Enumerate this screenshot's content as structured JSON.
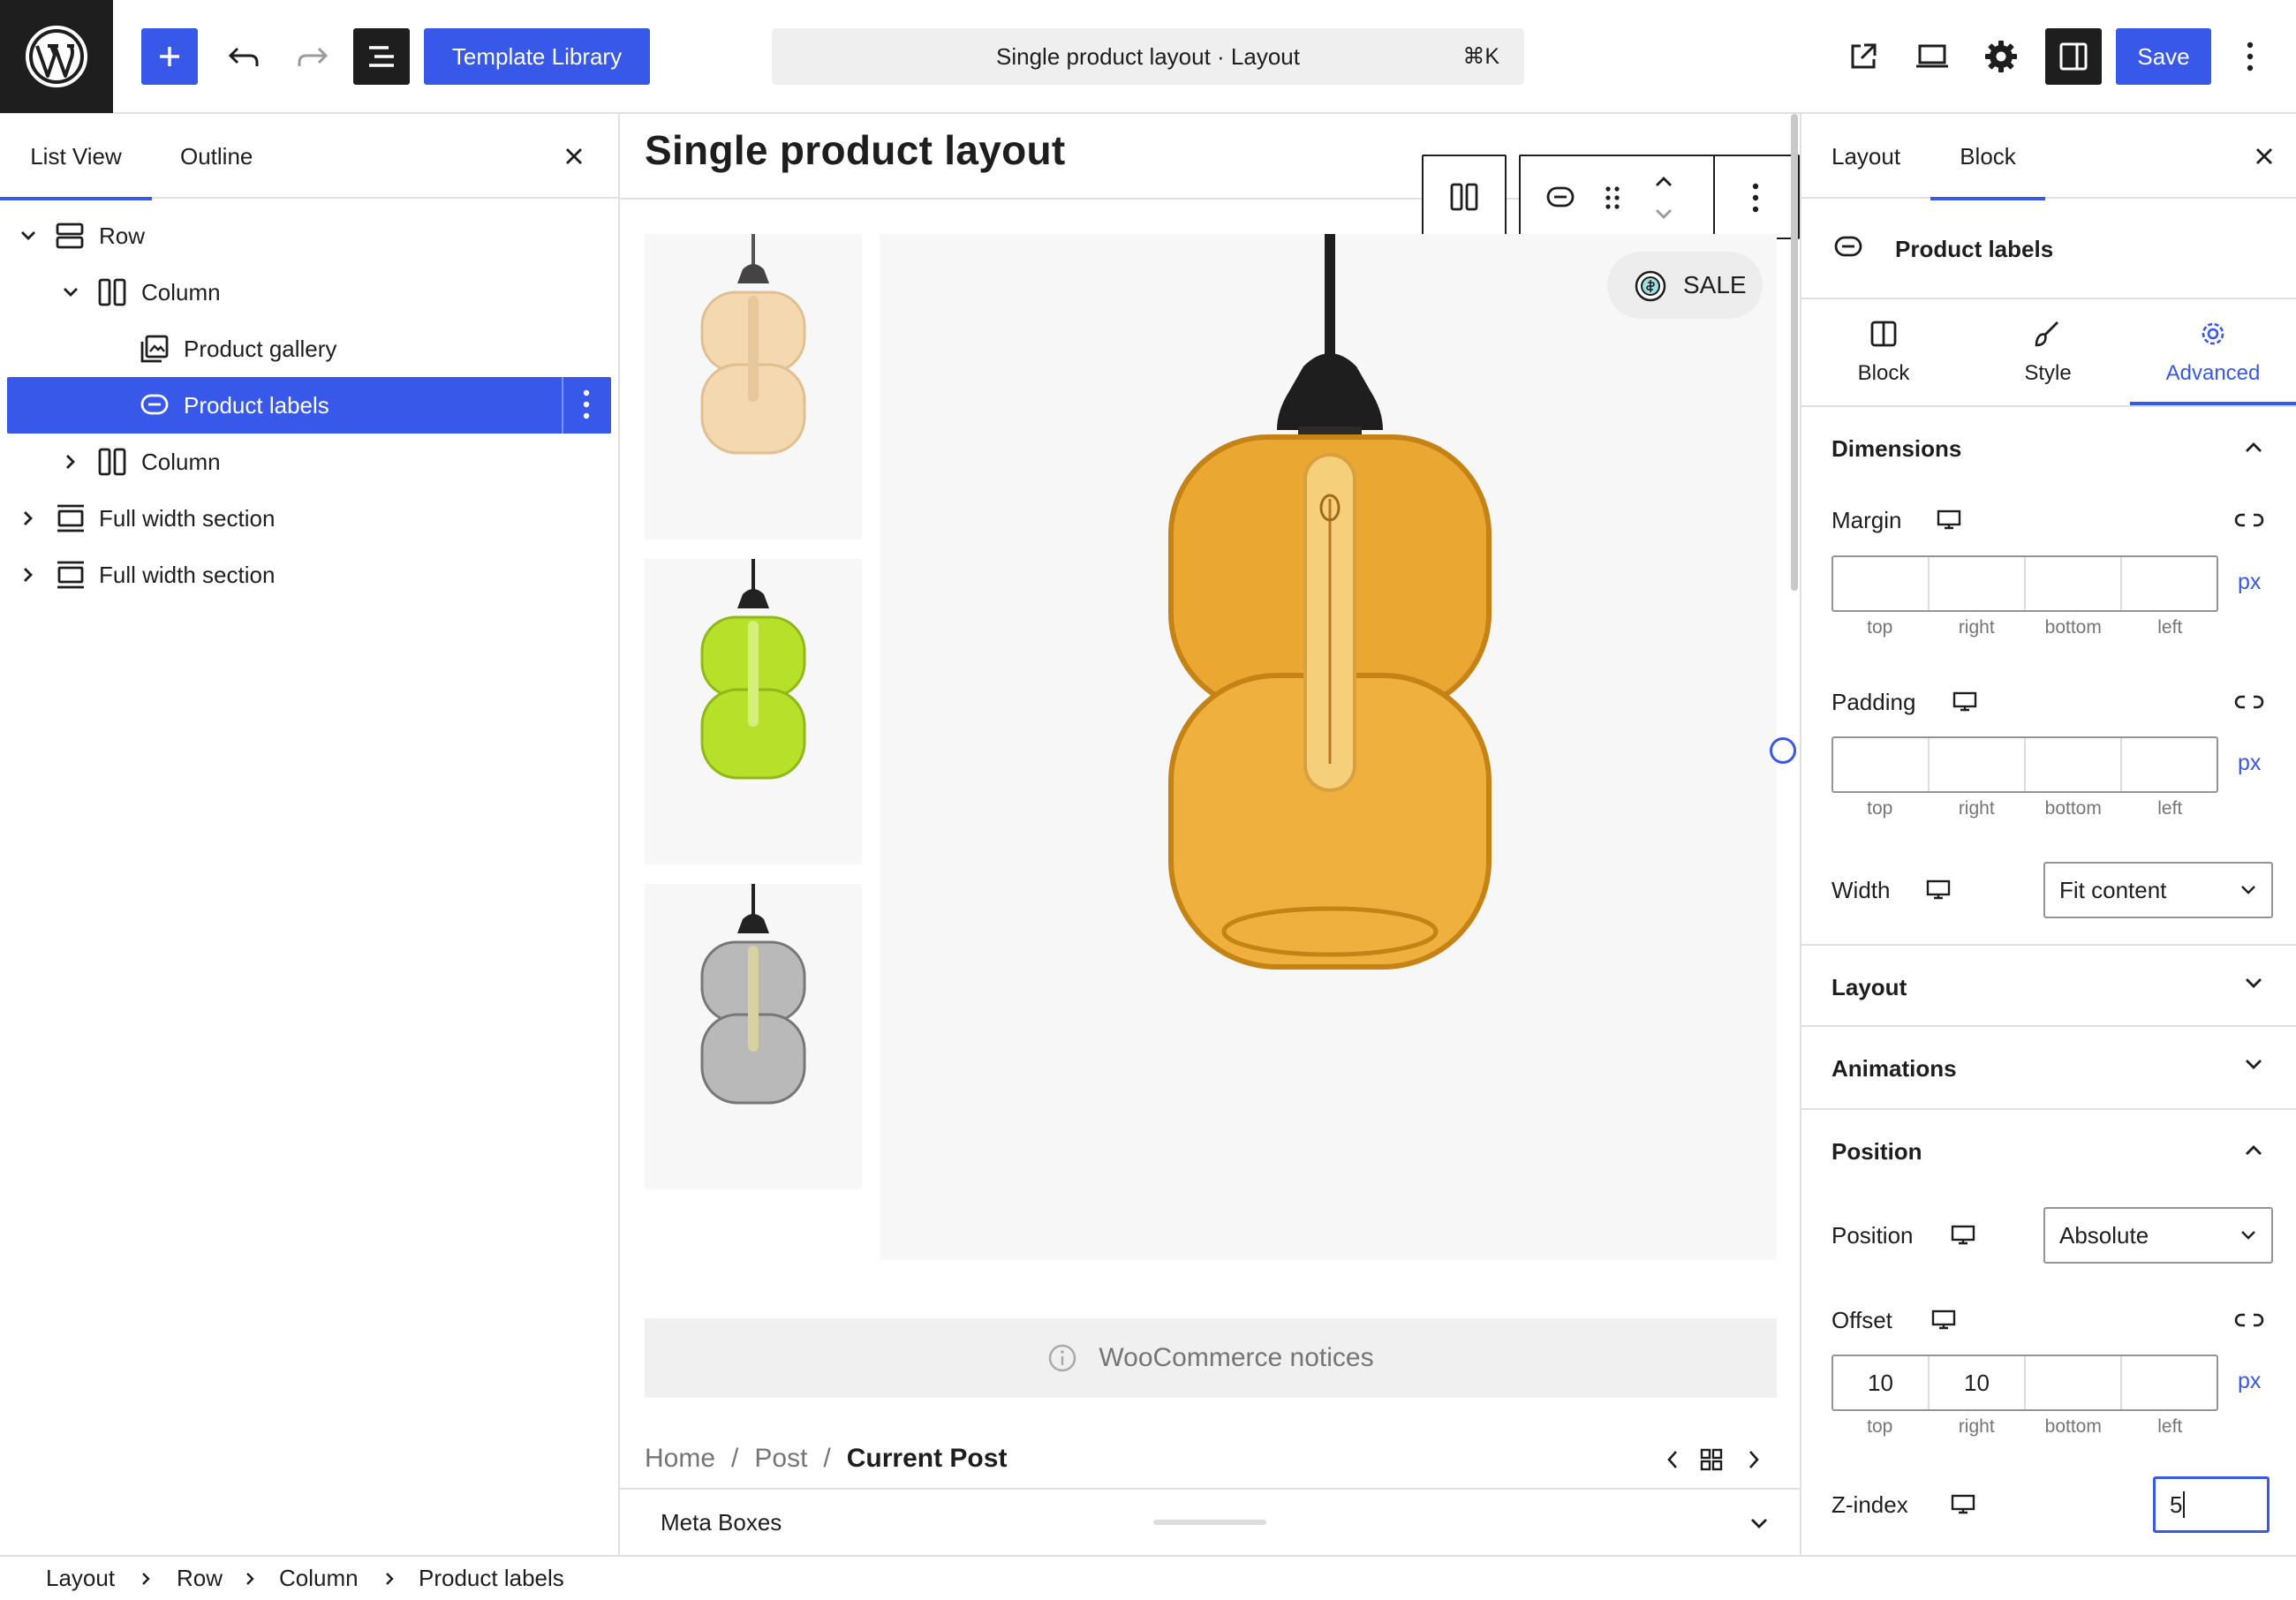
{
  "topbar": {
    "template_library_label": "Template Library",
    "command_title": "Single product layout · Layout",
    "command_shortcut": "⌘K",
    "save_label": "Save"
  },
  "left_panel": {
    "tabs": [
      "List View",
      "Outline"
    ],
    "tree": [
      {
        "label": "Row",
        "expanded": true
      },
      {
        "label": "Column",
        "expanded": true
      },
      {
        "label": "Product gallery"
      },
      {
        "label": "Product labels",
        "selected": true
      },
      {
        "label": "Column",
        "expanded": false
      },
      {
        "label": "Full width section",
        "expanded": false
      },
      {
        "label": "Full width section",
        "expanded": false
      }
    ]
  },
  "canvas": {
    "title": "Single product layout",
    "sale_badge": "SALE",
    "notices": "WooCommerce notices",
    "breadcrumb": [
      "Home",
      "/",
      "Post",
      "/",
      "Current Post"
    ],
    "meta_boxes": "Meta Boxes"
  },
  "right_panel": {
    "tabs": [
      "Layout",
      "Block"
    ],
    "block_name": "Product labels",
    "sub_tabs": [
      "Block",
      "Style",
      "Advanced"
    ],
    "dimensions": {
      "heading": "Dimensions",
      "margin_label": "Margin",
      "padding_label": "Padding",
      "sides": [
        "top",
        "right",
        "bottom",
        "left"
      ],
      "unit": "px",
      "width_label": "Width",
      "width_value": "Fit content"
    },
    "layout_heading": "Layout",
    "animations_heading": "Animations",
    "position": {
      "heading": "Position",
      "position_label": "Position",
      "position_value": "Absolute",
      "offset_label": "Offset",
      "offset_values": [
        "10",
        "10",
        "",
        ""
      ],
      "zindex_label": "Z-index",
      "zindex_value": "5"
    }
  },
  "status_bar": {
    "crumbs": [
      "Layout",
      "Row",
      "Column",
      "Product labels"
    ]
  },
  "colors": {
    "accent": "#3858e9",
    "dark": "#1e1e1e",
    "border": "#e0e0e0"
  }
}
